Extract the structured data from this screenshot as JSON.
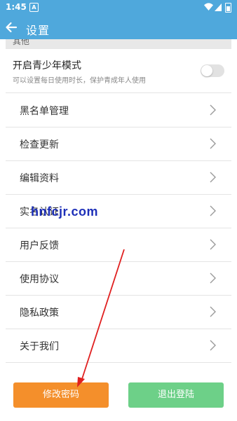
{
  "status_bar": {
    "time": "1:45",
    "notification_glyph": "A"
  },
  "title_bar": {
    "back_icon": "arrow-left-icon",
    "title": "设置"
  },
  "section": {
    "label": "其他"
  },
  "teen_mode": {
    "title": "开启青少年模式",
    "subtitle": "可以设置每日使用时长，保护青成年人使用",
    "enabled": false
  },
  "menu": [
    {
      "label": "黑名单管理"
    },
    {
      "label": "检查更新"
    },
    {
      "label": "编辑资料"
    },
    {
      "label": "实名认证"
    },
    {
      "label": "用户反馈"
    },
    {
      "label": "使用协议"
    },
    {
      "label": "隐私政策"
    },
    {
      "label": "关于我们"
    }
  ],
  "watermark": "hnfcjr.com",
  "buttons": {
    "change_password": "修改密码",
    "logout": "退出登陆"
  },
  "colors": {
    "header_blue": "#4fa8dc",
    "change_password_orange": "#f48f2b",
    "logout_green": "#6dd088",
    "annotation_red": "#e02020",
    "watermark_blue": "#1d2fb8"
  }
}
